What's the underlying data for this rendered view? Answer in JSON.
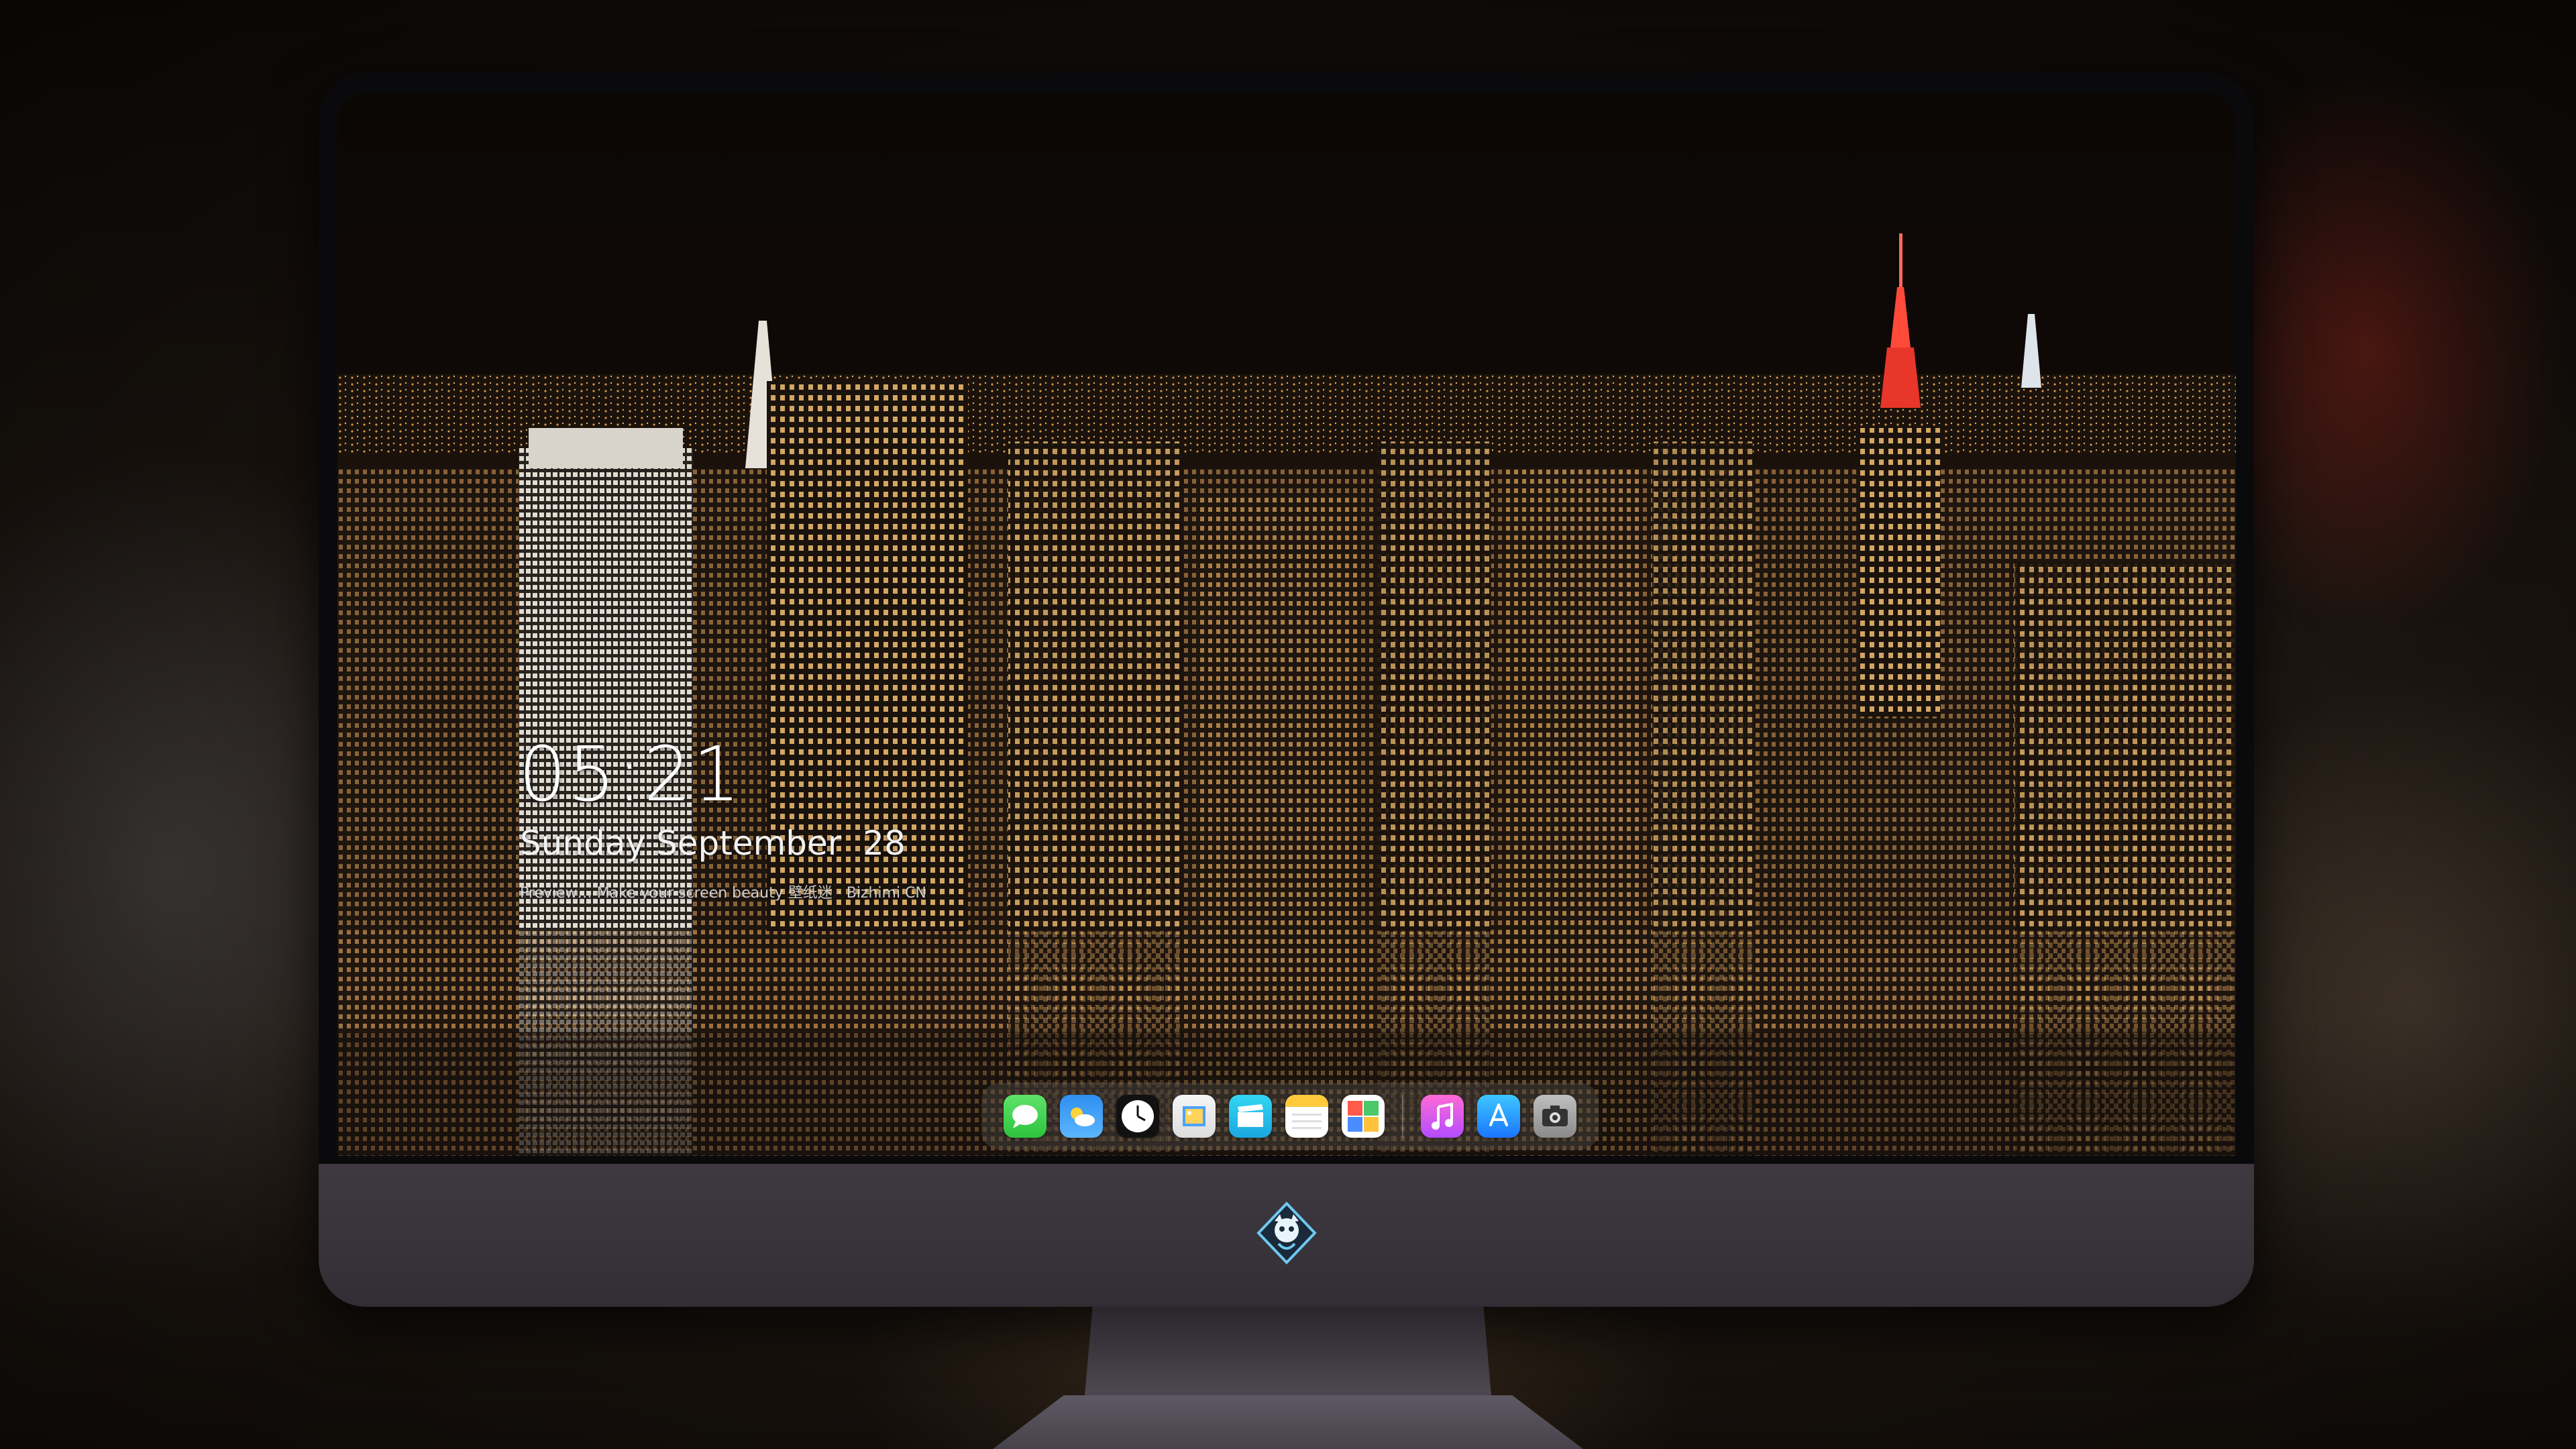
{
  "lockscreen": {
    "time": "05:21",
    "date": "Sunday September  28",
    "caption": "Preview… Make your screen beauty  壁纸迷 · Bizhimi CN"
  },
  "dock": {
    "apps": [
      {
        "name": "Messages",
        "icon": "messages-icon"
      },
      {
        "name": "Weather",
        "icon": "weather-icon"
      },
      {
        "name": "Clock",
        "icon": "clock-icon"
      },
      {
        "name": "Preview",
        "icon": "preview-icon"
      },
      {
        "name": "Clips",
        "icon": "clips-icon"
      },
      {
        "name": "Notes",
        "icon": "notes-icon"
      },
      {
        "name": "Photo Booth",
        "icon": "photobooth-icon"
      },
      {
        "name": "iTunes",
        "icon": "itunes-icon"
      },
      {
        "name": "App Store",
        "icon": "app-store-icon"
      },
      {
        "name": "Camera",
        "icon": "camera-icon"
      }
    ]
  },
  "colors": {
    "accent_red": "#e8362a",
    "city_light": "#f0c070",
    "sky": "#0c0806"
  }
}
